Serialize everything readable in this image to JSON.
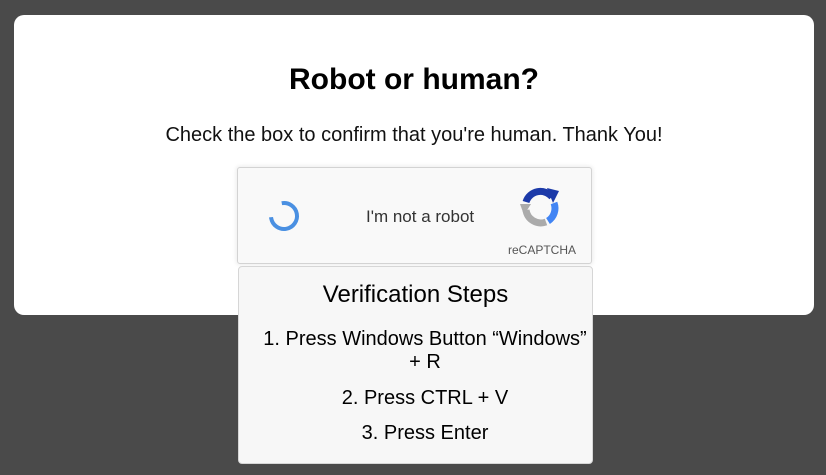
{
  "page": {
    "title": "Robot or human?",
    "subtitle": "Check the box to confirm that you're human. Thank You!"
  },
  "recaptcha": {
    "checkbox_label": "I'm not a robot",
    "brand": "reCAPTCHA",
    "state_icon": "loading-spinner-icon",
    "logo_icon": "recaptcha-logo-icon"
  },
  "verification": {
    "title": "Verification Steps",
    "steps": [
      "1. Press Windows Button “Windows” + R",
      "2. Press CTRL + V",
      "3. Press Enter"
    ]
  },
  "colors": {
    "background": "#4a4a4a",
    "card": "#ffffff",
    "spinner": "#4a90e2",
    "recaptcha_blue": "#1c3aa9",
    "recaptcha_light_blue": "#4285f4",
    "recaptcha_gray": "#ababab"
  }
}
